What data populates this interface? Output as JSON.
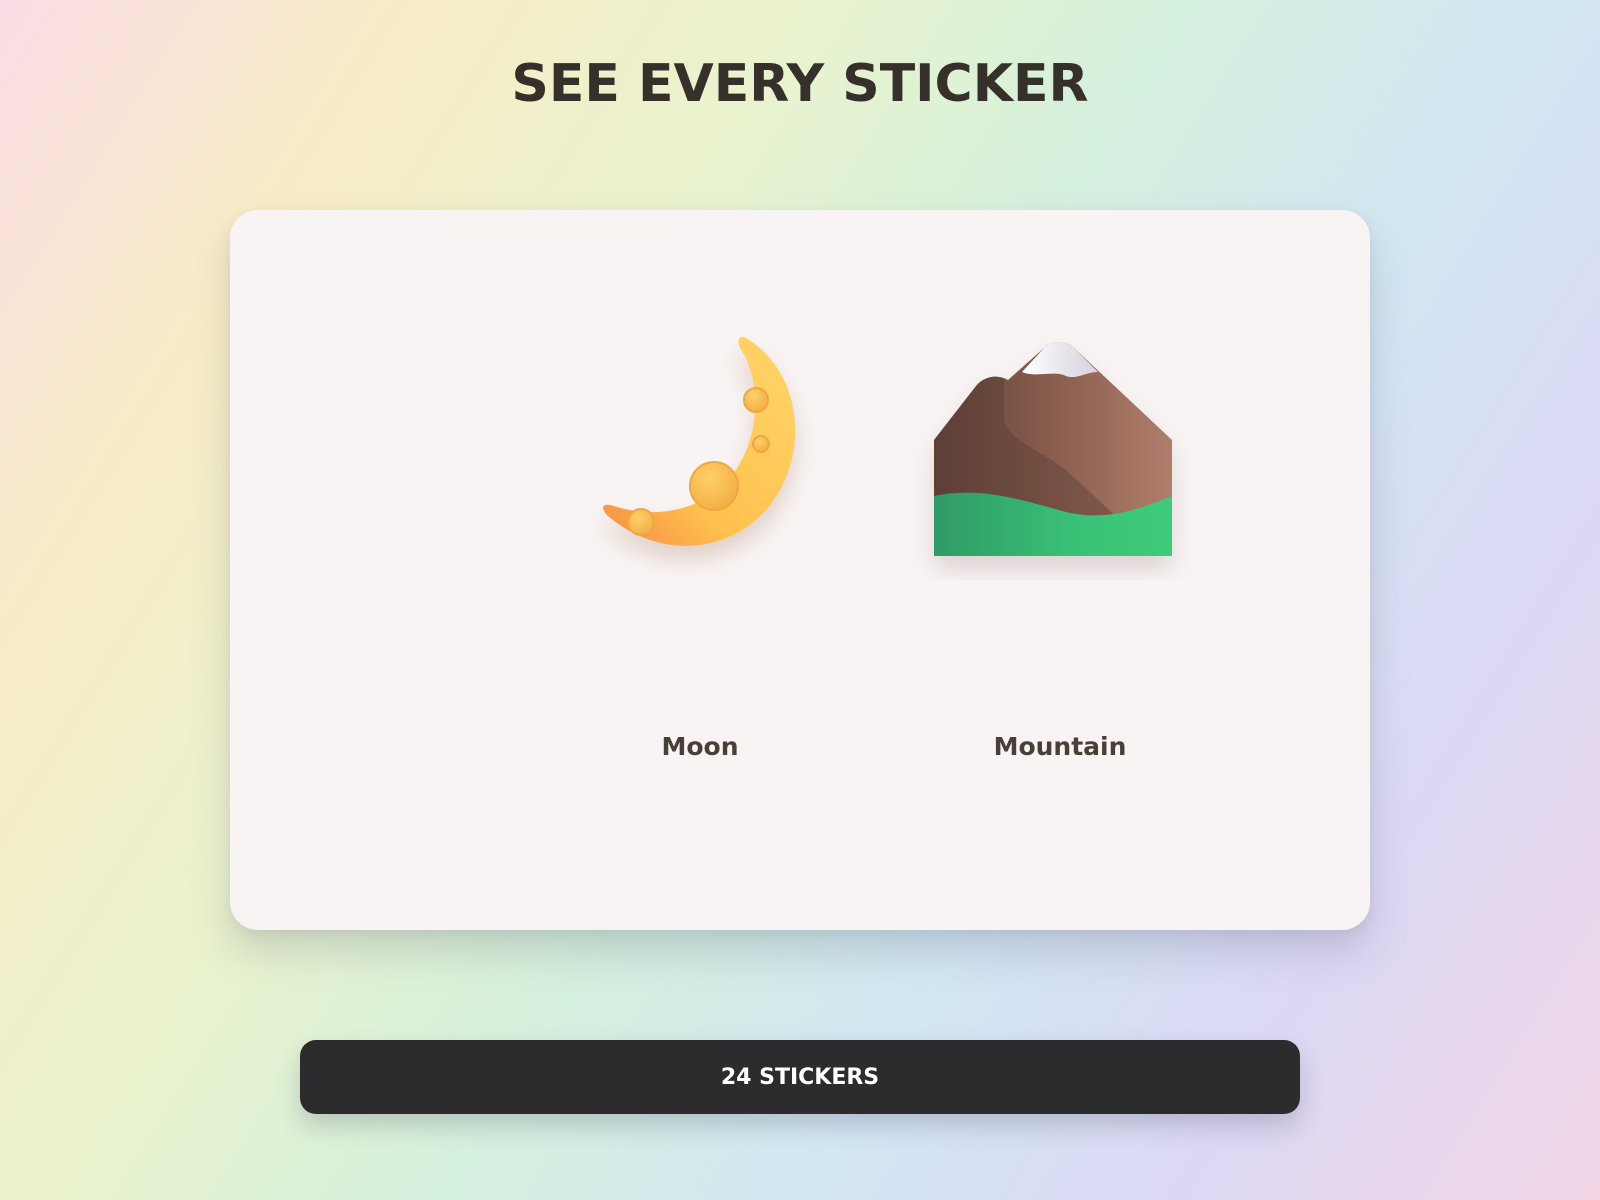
{
  "header": {
    "title": "SEE EVERY STICKER"
  },
  "stickers": [
    {
      "name": "Moon",
      "icon": "crescent-moon-icon",
      "colors": {
        "main": "#ffc547",
        "shade": "#f5964a"
      }
    },
    {
      "name": "Mountain",
      "icon": "mountain-icon",
      "colors": {
        "rock": "#8a5e4e",
        "snow": "#e6e1e8",
        "grass": "#38c475"
      }
    }
  ],
  "footer": {
    "count_label": "24 STICKERS"
  },
  "colors": {
    "title": "#36302b",
    "card": "#f9f4f4",
    "button": "#2c2c2f",
    "label": "#4a3f37"
  }
}
